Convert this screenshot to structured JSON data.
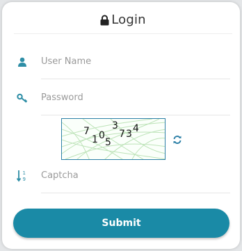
{
  "header": {
    "title": "Login",
    "icon": "lock-icon"
  },
  "username": {
    "placeholder": "User Name",
    "icon": "user-icon"
  },
  "password": {
    "placeholder": "Password",
    "icon": "key-icon"
  },
  "captcha": {
    "digits": [
      "7",
      "1",
      "0",
      "5",
      "3",
      "7",
      "3",
      "4"
    ],
    "refresh_icon": "refresh-icon",
    "input_placeholder": "Captcha",
    "input_icon": "sort-numeric-icon"
  },
  "submit": {
    "label": "Submit"
  },
  "colors": {
    "accent": "#1a8aa6",
    "icon": "#2e8ea6",
    "captcha_border": "#2b7fa6",
    "background": "#e4e6e8"
  }
}
